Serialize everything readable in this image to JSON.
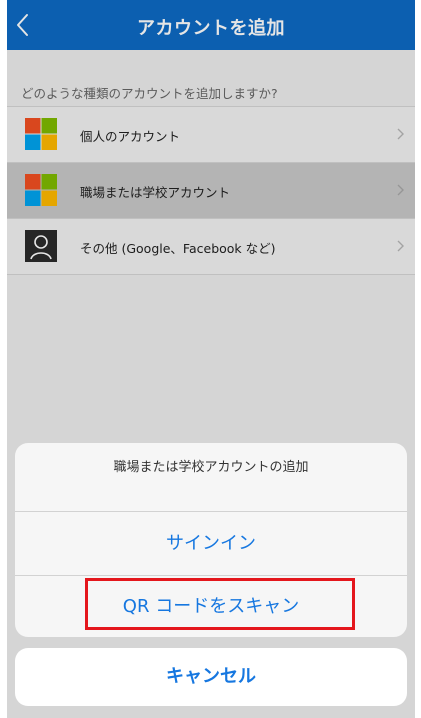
{
  "header": {
    "title": "アカウントを追加",
    "back_icon": "chevron-left-icon",
    "color": "#0e6ac5"
  },
  "question": "どのような種類のアカウントを追加しますか?",
  "account_types": [
    {
      "label": "個人のアカウント",
      "icon": "microsoft-logo-icon",
      "selected": false
    },
    {
      "label": "職場または学校アカウント",
      "icon": "microsoft-logo-icon",
      "selected": true
    },
    {
      "label": "その他 (Google、Facebook など)",
      "icon": "person-icon",
      "selected": false
    }
  ],
  "action_sheet": {
    "title": "職場または学校アカウントの追加",
    "sign_in_label": "サインイン",
    "qr_scan_label": "QR コードをスキャン",
    "highlight_color": "#e4161c"
  },
  "cancel_label": "キャンセル",
  "accent_color": "#1677e0"
}
